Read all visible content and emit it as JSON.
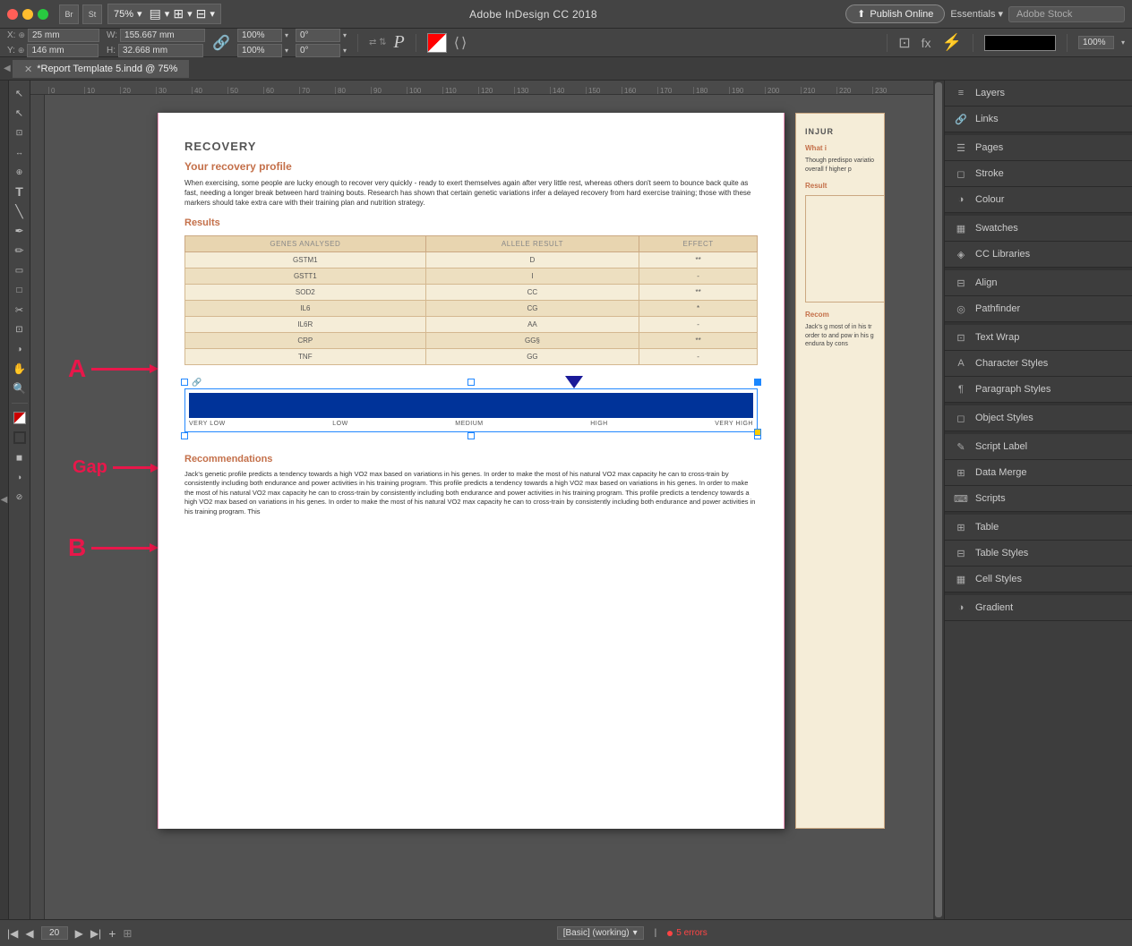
{
  "app": {
    "title": "Adobe InDesign CC 2018",
    "publish_btn": "Publish Online",
    "essentials_btn": "Essentials",
    "search_placeholder": "Adobe Stock"
  },
  "toolbar": {
    "zoom": "75%",
    "x_label": "X:",
    "y_label": "Y:",
    "w_label": "W:",
    "h_label": "H:",
    "x_val": "25 mm",
    "y_val": "146 mm",
    "w_val": "155.667 mm",
    "h_val": "32.668 mm",
    "pct1": "100%",
    "pct2": "100%",
    "angle1": "0°",
    "angle2": "0°"
  },
  "tab": {
    "label": "*Report Template 5.indd @ 75%",
    "modified": true
  },
  "annotations": {
    "a_label": "A",
    "b_label": "B",
    "gap_label": "Gap"
  },
  "page": {
    "section": "RECOVERY",
    "your_recovery_profile": "Your recovery profile",
    "body1": "When exercising, some people are lucky enough to recover very quickly - ready to exert themselves again after very little rest, whereas others don't seem to bounce back quite as fast, needing a longer break between hard training bouts. Research has shown that certain genetic variations infer a delayed recovery from hard exercise training; those with these markers should take extra care with their training plan and nutrition strategy.",
    "results": "Results",
    "table": {
      "headers": [
        "GENES ANALYSED",
        "ALLELE RESULT",
        "EFFECT"
      ],
      "rows": [
        [
          "GSTM1",
          "D",
          "**"
        ],
        [
          "GSTT1",
          "I",
          "-"
        ],
        [
          "SOD2",
          "CC",
          "**"
        ],
        [
          "IL6",
          "CG",
          "*"
        ],
        [
          "IL6R",
          "AA",
          "-"
        ],
        [
          "CRP",
          "GG§",
          "**"
        ],
        [
          "TNF",
          "GG",
          "-"
        ]
      ]
    },
    "chart_labels": [
      "VERY LOW",
      "LOW",
      "MEDIUM",
      "HIGH",
      "VERY HIGH"
    ],
    "recommendations_title": "Recommendations",
    "recommendations_text": "Jack's genetic profile predicts a tendency towards a high VO2 max based on variations in his genes. In order to make the most of his natural VO2 max capacity he can to cross-train by consistently including both endurance and power activities in his training program. This profile predicts a tendency towards a high VO2 max based on variations in his genes. In order to make the most of his natural VO2 max capacity he can to cross-train by consistently including both endurance and power activities in his training program. This profile predicts a tendency towards a high VO2 max based on variations in his genes. In order to make the most of his natural VO2 max capacity he can to cross-train by consistently including both endurance and power activities in his training program. This"
  },
  "right_page_partial": {
    "title": "INJUR",
    "what_label": "What i",
    "body": "Though predispo variatio overall f higher p",
    "results_label": "Result",
    "rec_label": "Recom",
    "rec_body": "Jack's g most of in his tr order to and pow in his g endura by cons"
  },
  "right_panel": {
    "items": [
      {
        "id": "layers",
        "label": "Layers",
        "icon": "layers-icon"
      },
      {
        "id": "links",
        "label": "Links",
        "icon": "links-icon"
      },
      {
        "id": "pages",
        "label": "Pages",
        "icon": "pages-icon"
      },
      {
        "id": "stroke",
        "label": "Stroke",
        "icon": "stroke-icon"
      },
      {
        "id": "colour",
        "label": "Colour",
        "icon": "colour-icon"
      },
      {
        "id": "swatches",
        "label": "Swatches",
        "icon": "swatches-icon"
      },
      {
        "id": "cc-libraries",
        "label": "CC Libraries",
        "icon": "cc-libraries-icon"
      },
      {
        "id": "align",
        "label": "Align",
        "icon": "align-icon"
      },
      {
        "id": "pathfinder",
        "label": "Pathfinder",
        "icon": "pathfinder-icon"
      },
      {
        "id": "text-wrap",
        "label": "Text Wrap",
        "icon": "text-wrap-icon"
      },
      {
        "id": "character-styles",
        "label": "Character Styles",
        "icon": "character-styles-icon"
      },
      {
        "id": "paragraph-styles",
        "label": "Paragraph Styles",
        "icon": "paragraph-styles-icon"
      },
      {
        "id": "object-styles",
        "label": "Object Styles",
        "icon": "object-styles-icon"
      },
      {
        "id": "script-label",
        "label": "Script Label",
        "icon": "script-label-icon"
      },
      {
        "id": "data-merge",
        "label": "Data Merge",
        "icon": "data-merge-icon"
      },
      {
        "id": "scripts",
        "label": "Scripts",
        "icon": "scripts-icon"
      },
      {
        "id": "table",
        "label": "Table",
        "icon": "table-icon"
      },
      {
        "id": "table-styles",
        "label": "Table Styles",
        "icon": "table-styles-icon"
      },
      {
        "id": "cell-styles",
        "label": "Cell Styles",
        "icon": "cell-styles-icon"
      },
      {
        "id": "gradient",
        "label": "Gradient",
        "icon": "gradient-icon"
      }
    ]
  },
  "status_bar": {
    "page_num": "20",
    "mode": "[Basic] (working)",
    "errors": "5 errors"
  }
}
